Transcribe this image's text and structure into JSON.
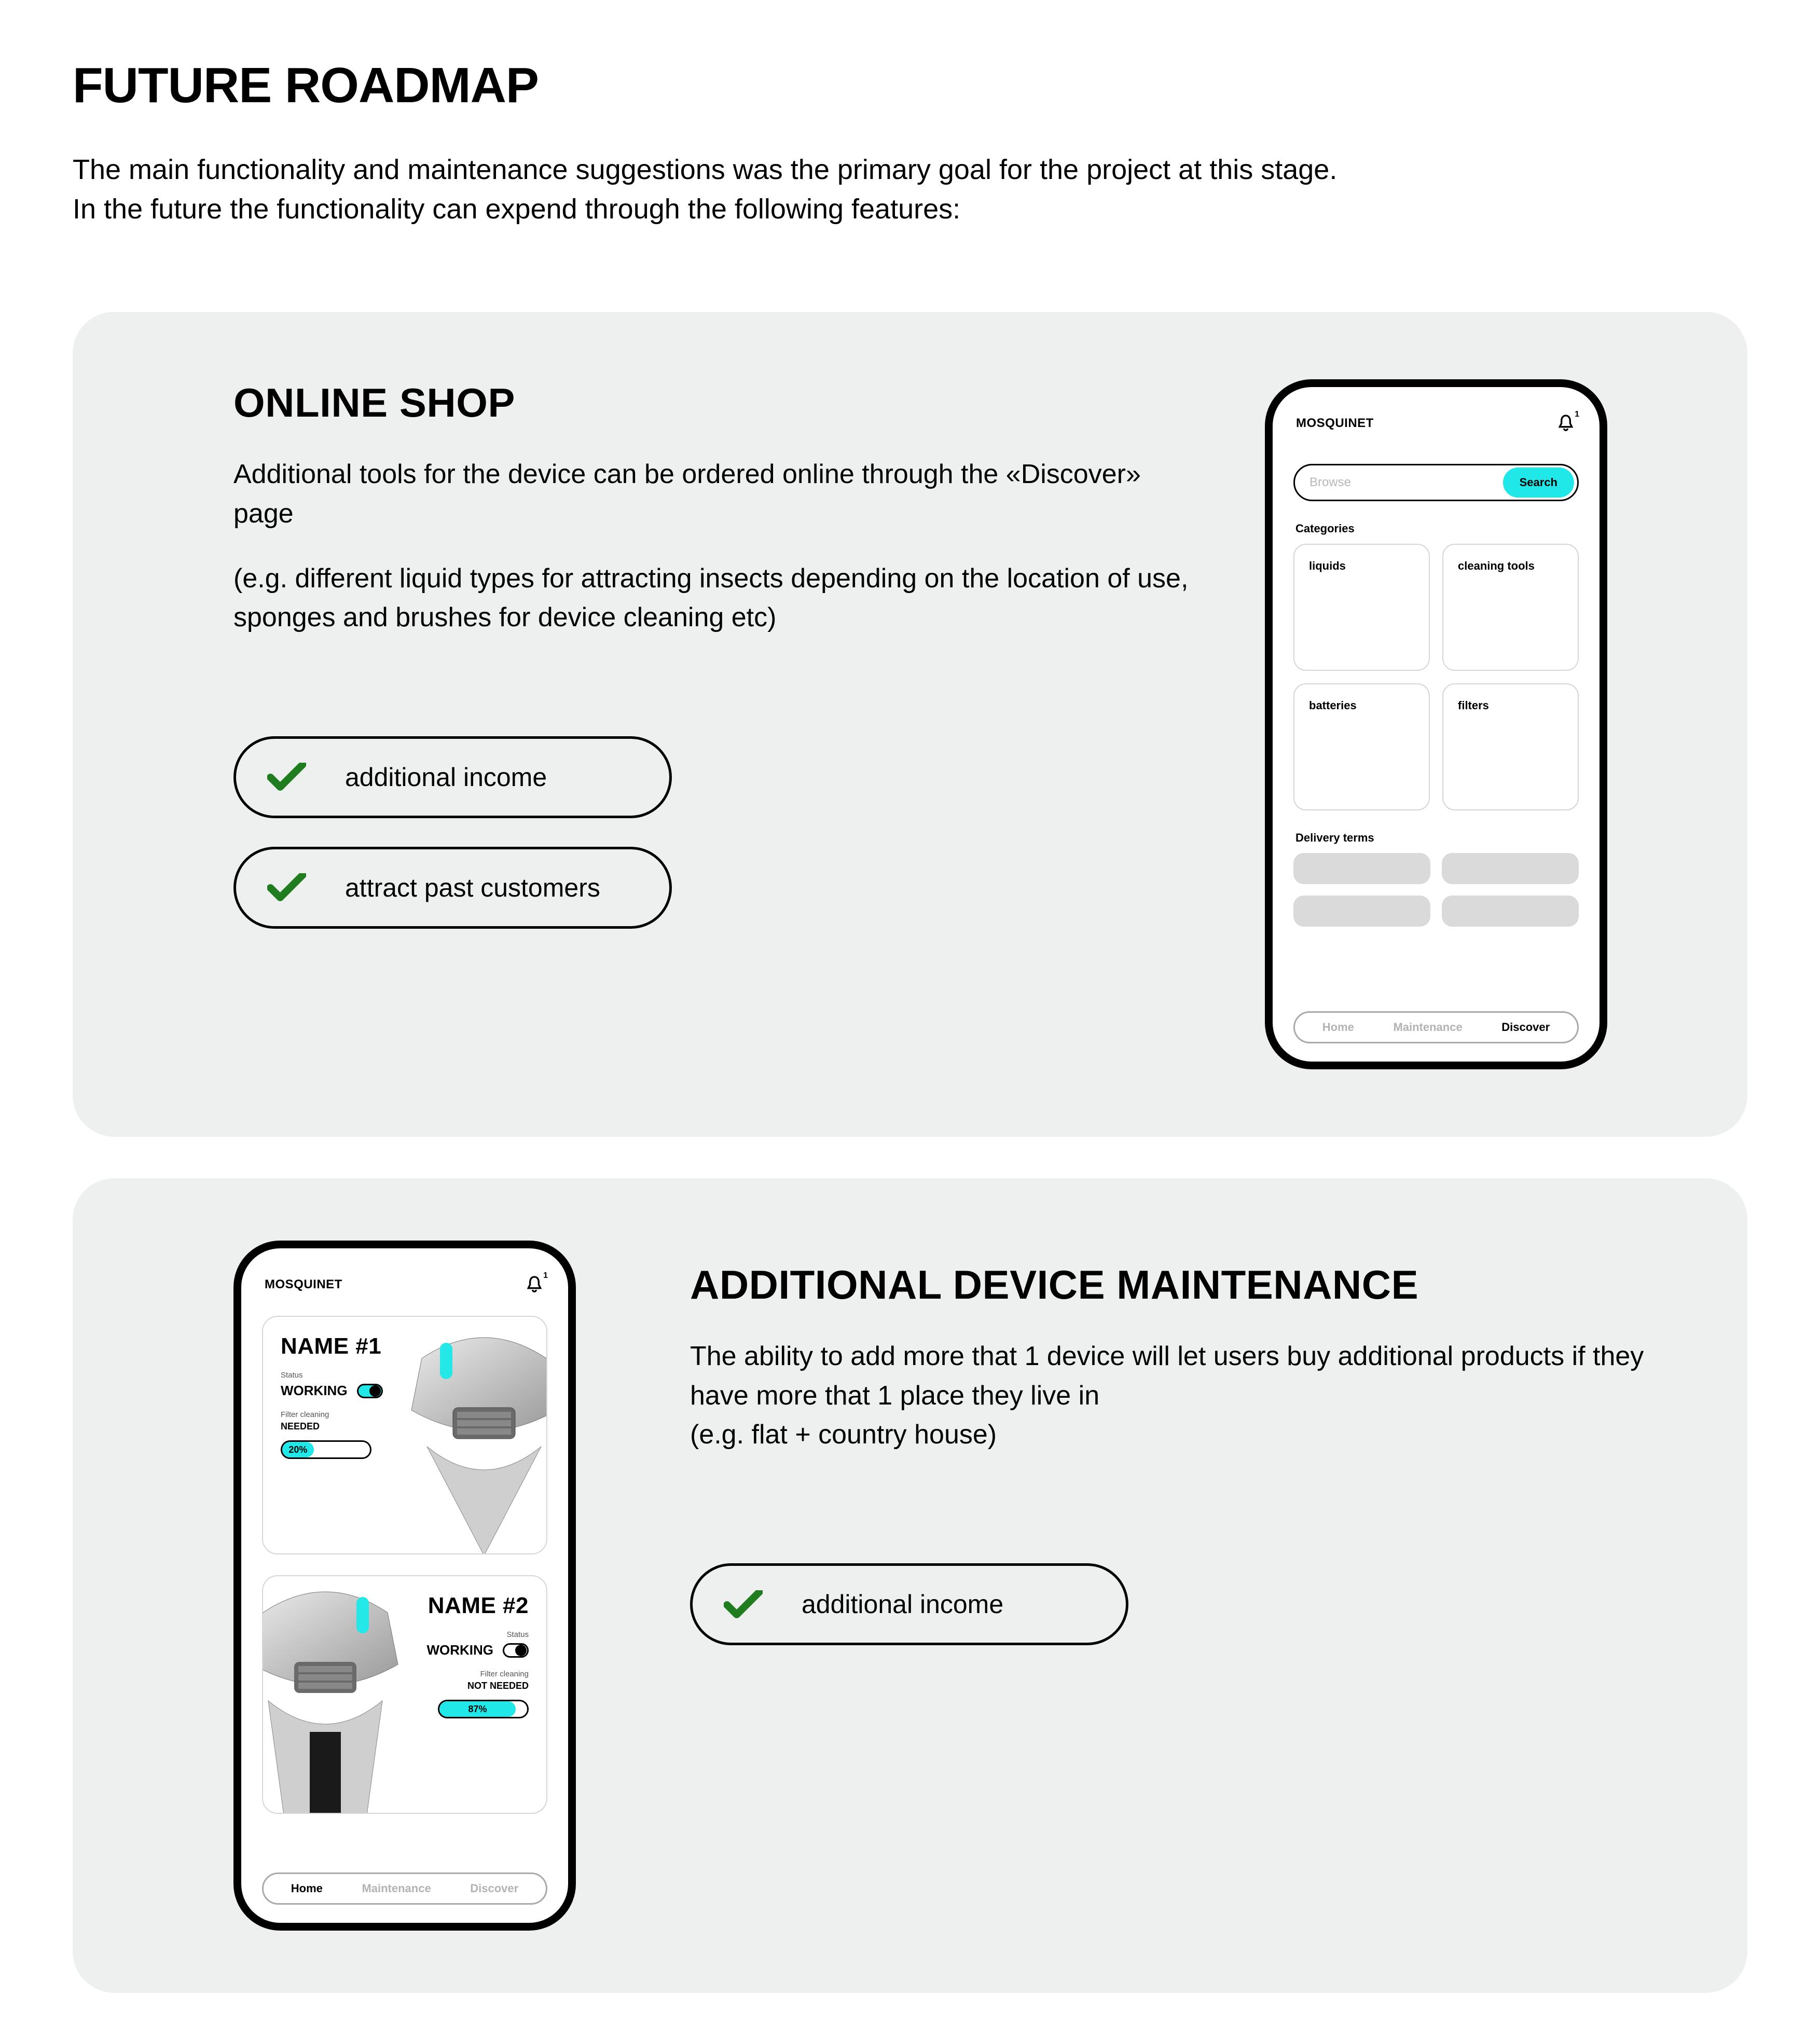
{
  "page": {
    "title": "FUTURE ROADMAP",
    "intro_line1": "The main functionality and maintenance suggestions was the primary goal for the project at this stage.",
    "intro_line2": "In the future the functionality can expend through the following features:"
  },
  "shop": {
    "title": "ONLINE SHOP",
    "body_p1": "Additional tools for the device can be ordered online through the «Discover» page",
    "body_p2": "(e.g. different liquid types for attracting insects depending on the location of use, sponges and brushes for device cleaning etc)",
    "pill1": "additional income",
    "pill2": "attract past customers",
    "phone": {
      "brand": "MOSQUINET",
      "notif_badge": "1",
      "search_placeholder": "Browse",
      "search_button": "Search",
      "categories_label": "Categories",
      "categories": [
        "liquids",
        "cleaning tools",
        "batteries",
        "filters"
      ],
      "delivery_label": "Delivery terms",
      "nav": {
        "home": "Home",
        "maintenance": "Maintenance",
        "discover": "Discover",
        "active": "discover"
      }
    }
  },
  "devices": {
    "title": "ADDITIONAL DEVICE MAINTENANCE",
    "body_p1": "The ability to add more that 1 device will let users buy additional products if they have more that 1 place they live in",
    "body_p2": "(e.g. flat + country house)",
    "pill1": "additional income",
    "phone": {
      "brand": "MOSQUINET",
      "notif_badge": "1",
      "nav": {
        "home": "Home",
        "maintenance": "Maintenance",
        "discover": "Discover",
        "active": "home"
      },
      "cards": [
        {
          "name": "NAME #1",
          "status_label": "Status",
          "status_value": "WORKING",
          "toggle_on": true,
          "filter_label": "Filter cleaning",
          "filter_value": "NEEDED",
          "progress": "20%",
          "progress_pct": 36
        },
        {
          "name": "NAME #2",
          "status_label": "Status",
          "status_value": "WORKING",
          "toggle_on": false,
          "filter_label": "Filter cleaning",
          "filter_value": "NOT NEEDED",
          "progress": "87%",
          "progress_pct": 87
        }
      ]
    }
  }
}
